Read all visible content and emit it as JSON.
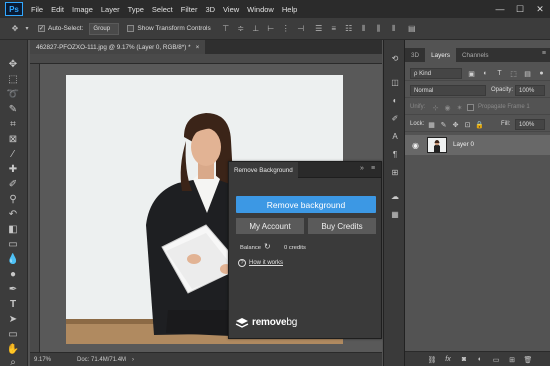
{
  "app": {
    "logo": "Ps"
  },
  "menu": [
    "File",
    "Edit",
    "Image",
    "Layer",
    "Type",
    "Select",
    "Filter",
    "3D",
    "View",
    "Window",
    "Help"
  ],
  "window_controls": {
    "minimize": "—",
    "maximize": "☐",
    "close": "✕"
  },
  "options": {
    "auto_select_label": "Auto-Select:",
    "auto_select_checked": "✓",
    "group_value": "Group",
    "show_transform_label": "Show Transform Controls"
  },
  "document": {
    "tab_title": "462827-PFOZXO-111.jpg @ 9.17% (Layer 0, RGB/8*) *",
    "tab_close": "×"
  },
  "status": {
    "zoom": "9.17%",
    "doc_info": "Doc: 71.4M/71.4M",
    "arrow": "›"
  },
  "plugin": {
    "tab_title": "Remove Background",
    "collapse": "»",
    "menu": "≡",
    "remove_bg_label": "Remove background",
    "my_account_label": "My Account",
    "buy_credits_label": "Buy Credits",
    "balance_label": "Balance",
    "refresh": "↻",
    "credits_value": "0 credits",
    "help_icon": "?",
    "how_it_works": "How it works",
    "logo_word": "remove",
    "logo_suffix": "bg",
    "accent": "#3c98e4"
  },
  "layers_panel": {
    "tabs": [
      "3D",
      "Layers",
      "Channels"
    ],
    "menu": "≡",
    "filter_kind": "ρ Kind",
    "blend_mode": "Normal",
    "opacity_label": "Opacity:",
    "opacity_value": "100%",
    "unify_label": "Unify:",
    "propagate_label": "Propagate Frame 1",
    "lock_label": "Lock:",
    "fill_label": "Fill:",
    "fill_value": "100%",
    "layer_name": "Layer 0"
  }
}
